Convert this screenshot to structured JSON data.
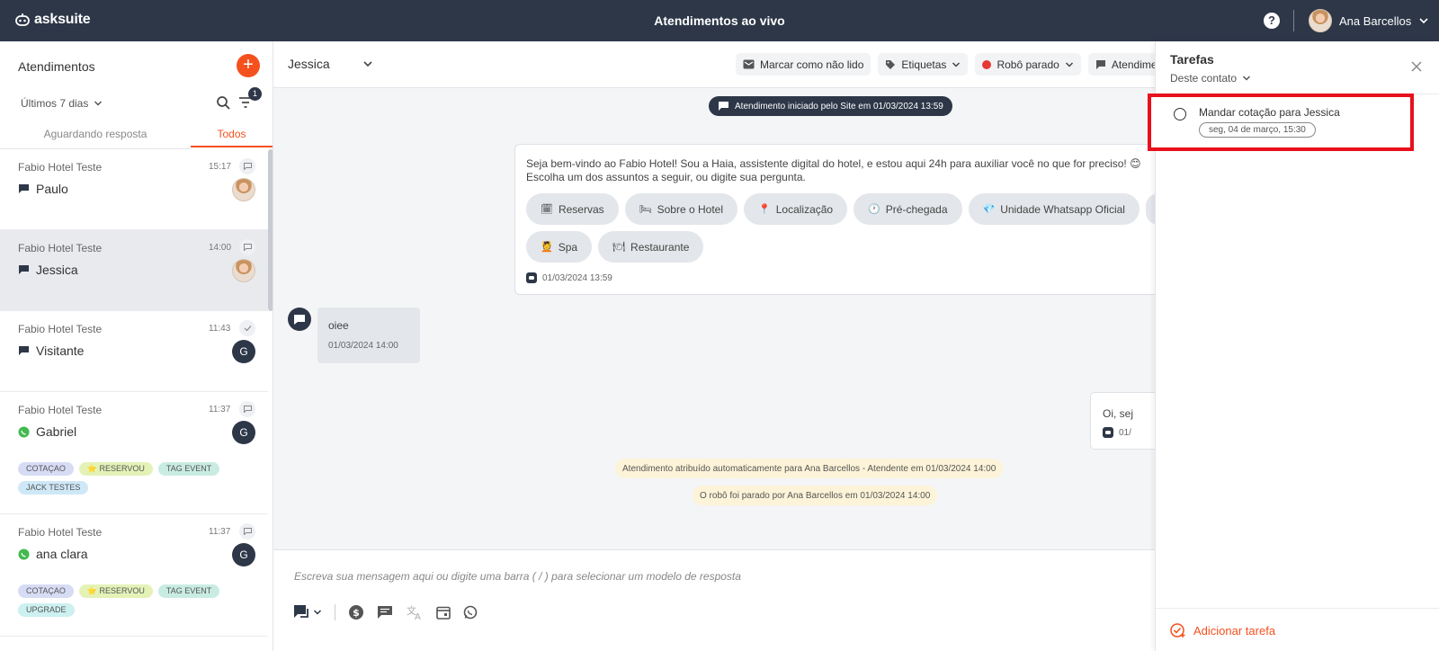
{
  "app": {
    "brand": "asksuite",
    "page_title": "Atendimentos ao vivo",
    "help_label": "?"
  },
  "user": {
    "name": "Ana Barcellos"
  },
  "left_panel": {
    "title": "Atendimentos",
    "add_label": "+",
    "date_filter": "Últimos 7 dias",
    "filter_count": "1",
    "tabs": {
      "waiting": "Aguardando resposta",
      "all": "Todos"
    },
    "conversations": [
      {
        "company": "Fabio Hotel Teste",
        "time": "15:17",
        "name": "Paulo",
        "channel": "chat-icon",
        "avatar": "photo",
        "status": "chat",
        "active": false,
        "tags": []
      },
      {
        "company": "Fabio Hotel Teste",
        "time": "14:00",
        "name": "Jessica",
        "channel": "chat-icon",
        "avatar": "photo",
        "status": "chat",
        "active": true,
        "tags": []
      },
      {
        "company": "Fabio Hotel Teste",
        "time": "11:43",
        "name": "Visitante",
        "channel": "chat-icon",
        "avatar": "G",
        "status": "check",
        "active": false,
        "tags": []
      },
      {
        "company": "Fabio Hotel Teste",
        "time": "11:37",
        "name": "Gabriel",
        "channel": "whatsapp-icon",
        "avatar": "G",
        "status": "chat",
        "active": false,
        "tags": [
          {
            "label": "COTAÇAO",
            "color": "#d7dcf5"
          },
          {
            "label": "⭐ RESERVOU",
            "color": "#e4f2b8"
          },
          {
            "label": "TAG EVENT",
            "color": "#c9ece2"
          },
          {
            "label": "JACK TESTES",
            "color": "#cfe8f7"
          }
        ]
      },
      {
        "company": "Fabio Hotel Teste",
        "time": "11:37",
        "name": "ana clara",
        "channel": "whatsapp-icon",
        "avatar": "G",
        "status": "chat",
        "active": false,
        "tags": [
          {
            "label": "COTAÇAO",
            "color": "#d7dcf5"
          },
          {
            "label": "⭐ RESERVOU",
            "color": "#e4f2b8"
          },
          {
            "label": "TAG EVENT",
            "color": "#c9ece2"
          },
          {
            "label": "UPGRADE",
            "color": "#cdf0f0"
          }
        ]
      }
    ]
  },
  "chat": {
    "contact": "Jessica",
    "actions": {
      "mark_unread": "Marcar como não lido",
      "tags": "Etiquetas",
      "robot": "Robô parado",
      "attend": "Atendime"
    },
    "started_note": "Atendimento iniciado pelo Site em 01/03/2024 13:59",
    "bot_message": {
      "line1": "Seja bem-vindo ao Fabio Hotel! Sou a Haia, assistente digital do hotel, e estou aqui 24h para auxiliar você no que for preciso! 😊",
      "line2": "Escolha um dos assuntos a seguir, ou digite sua pergunta.",
      "options": [
        {
          "emoji": "🗓",
          "label": "Reservas"
        },
        {
          "emoji": "🛏",
          "label": "Sobre o Hotel"
        },
        {
          "emoji": "📍",
          "label": "Localização"
        },
        {
          "emoji": "🕐",
          "label": "Pré-chegada"
        },
        {
          "emoji": "💎",
          "label": "Unidade Whatsapp Oficial"
        },
        {
          "emoji": "",
          "label": ""
        },
        {
          "emoji": "💆",
          "label": "Spa"
        },
        {
          "emoji": "🍽",
          "label": "Restaurante"
        }
      ],
      "time": "01/03/2024 13:59"
    },
    "user_message": {
      "text": "oiee",
      "time": "01/03/2024 14:00"
    },
    "agent_message": {
      "text": "Oi, sej",
      "time": "01/"
    },
    "system_notes": [
      "Atendimento atribuído automaticamente para Ana Barcellos - Atendente em 01/03/2024 14:00",
      "O robô foi parado por Ana Barcellos em 01/03/2024 14:00"
    ],
    "composer_placeholder": "Escreva sua mensagem aqui ou digite uma barra ( / ) para selecionar um modelo de resposta"
  },
  "tasks": {
    "title": "Tarefas",
    "scope": "Deste contato",
    "items": [
      {
        "title": "Mandar cotação para Jessica",
        "date": "seg, 04 de março, 15:30"
      }
    ],
    "add_label": "Adicionar tarefa"
  },
  "colors": {
    "topbar": "#2d3748",
    "accent": "#f4511e",
    "highlight": "#e8101d"
  }
}
